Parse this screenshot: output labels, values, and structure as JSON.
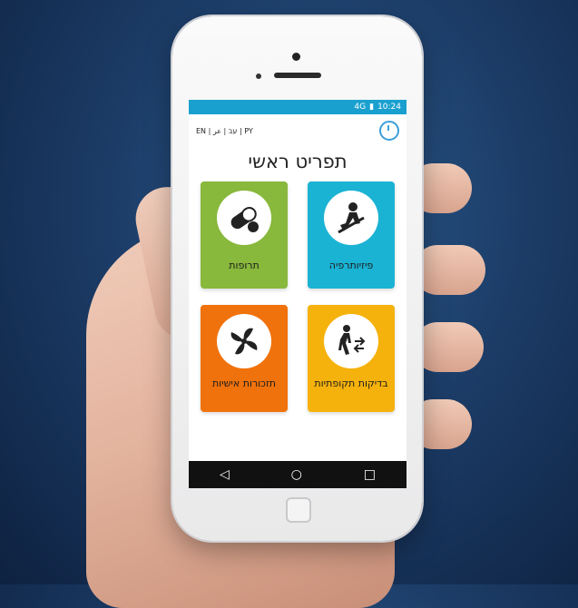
{
  "status": {
    "time": "10:24",
    "signal": "4G"
  },
  "languages": "EN | עב | عر | PY",
  "title": "תפריט ראשי",
  "tiles": [
    {
      "label": "פיזיותרפיה",
      "color": "#1bb3d4",
      "icon": "physio-icon"
    },
    {
      "label": "תרופות",
      "color": "#88b83c",
      "icon": "pills-icon"
    },
    {
      "label": "בדיקות תקופתיות",
      "color": "#f5b20c",
      "icon": "walking-icon"
    },
    {
      "label": "תזכורות אישיות",
      "color": "#f0720c",
      "icon": "fan-icon"
    }
  ],
  "nav": {
    "back": "◁",
    "home": "○",
    "recents": "□"
  }
}
